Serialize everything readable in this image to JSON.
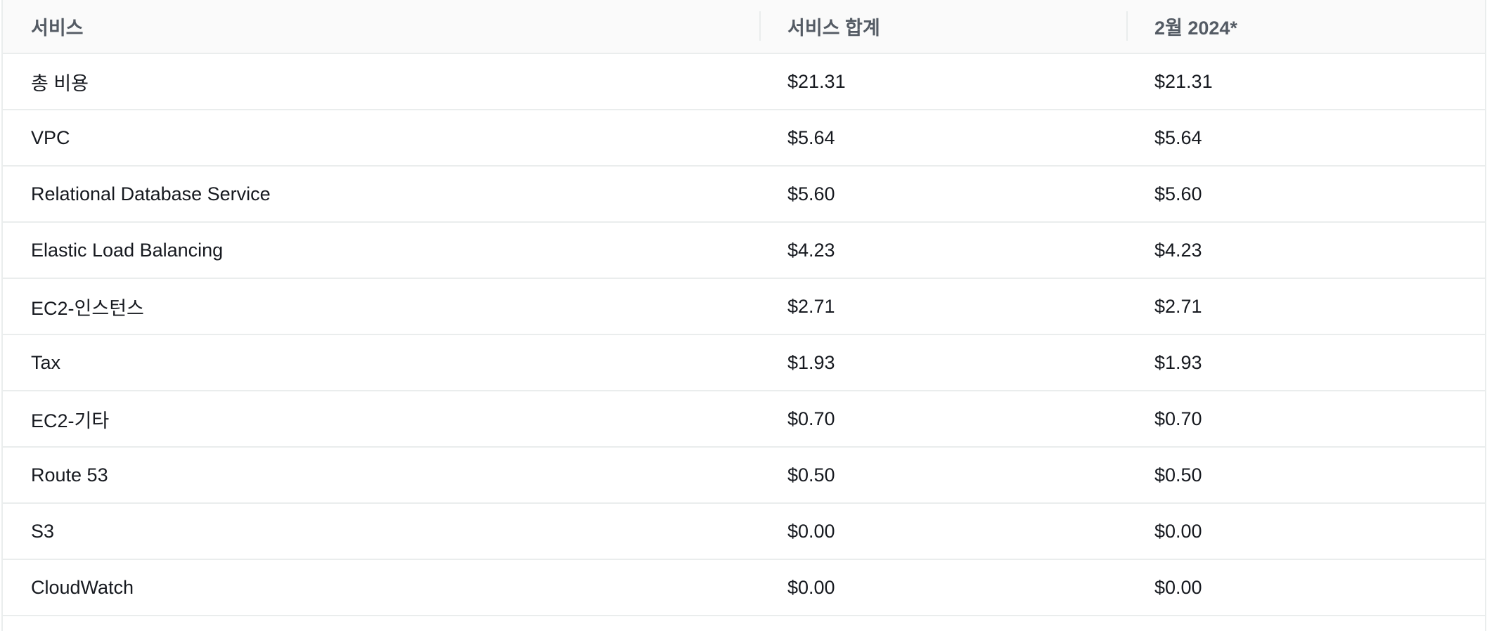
{
  "table": {
    "headers": [
      "서비스",
      "서비스 합계",
      "2월 2024*"
    ],
    "rows": [
      {
        "service": "총 비용",
        "total": "$21.31",
        "month": "$21.31"
      },
      {
        "service": "VPC",
        "total": "$5.64",
        "month": "$5.64"
      },
      {
        "service": "Relational Database Service",
        "total": "$5.60",
        "month": "$5.60"
      },
      {
        "service": "Elastic Load Balancing",
        "total": "$4.23",
        "month": "$4.23"
      },
      {
        "service": "EC2-인스턴스",
        "total": "$2.71",
        "month": "$2.71"
      },
      {
        "service": "Tax",
        "total": "$1.93",
        "month": "$1.93"
      },
      {
        "service": "EC2-기타",
        "total": "$0.70",
        "month": "$0.70"
      },
      {
        "service": "Route 53",
        "total": "$0.50",
        "month": "$0.50"
      },
      {
        "service": "S3",
        "total": "$0.00",
        "month": "$0.00"
      },
      {
        "service": "CloudWatch",
        "total": "$0.00",
        "month": "$0.00"
      }
    ]
  }
}
